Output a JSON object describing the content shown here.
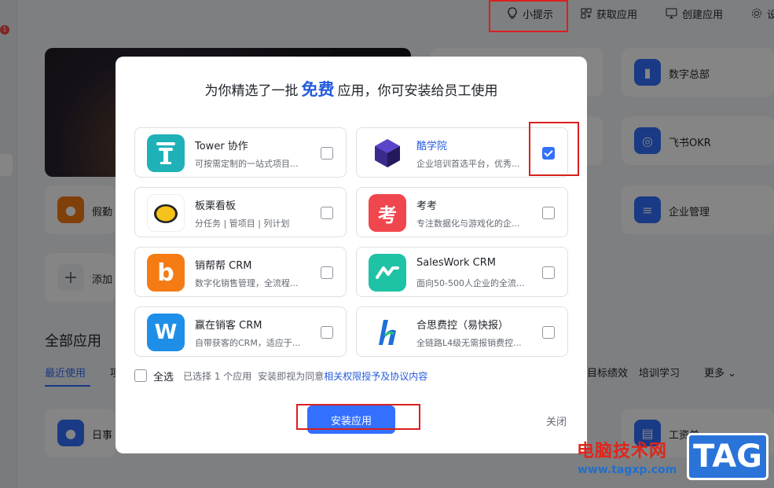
{
  "topbar": {
    "tips": "小提示",
    "get_apps": "获取应用",
    "create_app": "创建应用",
    "settings_partial": "设"
  },
  "background": {
    "cards": [
      "数字总部",
      "飞书OKR",
      "企业管理",
      "假勤",
      "添加"
    ],
    "section_title": "全部应用",
    "tabs": [
      "最近使用",
      "项",
      "目标绩效",
      "培训学习",
      "更多"
    ],
    "bottom_items": [
      "日事",
      "工资单"
    ]
  },
  "modal": {
    "title_prefix": "为你精选了一批",
    "title_highlight": "免费",
    "title_suffix": "应用，你可安装给员工使用",
    "apps": [
      {
        "name": "Tower 协作",
        "desc": "可按需定制的一站式项目...",
        "checked": false,
        "logo_color": "#1fb1b8",
        "icon": "tower-icon"
      },
      {
        "name": "酷学院",
        "desc": "企业培训首选平台，优秀...",
        "checked": true,
        "logo_color": "#3b2a8c",
        "icon": "cube-icon"
      },
      {
        "name": "板栗看板",
        "desc": "分任务 | 管项目 | 列计划",
        "checked": false,
        "logo_color": "#ffffff",
        "icon": "chestnut-icon"
      },
      {
        "name": "考考",
        "desc": "专注数据化与游戏化的企...",
        "checked": false,
        "logo_color": "#f0474e",
        "icon": "kao-icon"
      },
      {
        "name": "销帮帮 CRM",
        "desc": "数字化销售管理，全流程...",
        "checked": false,
        "logo_color": "#f57c15",
        "icon": "b-letter-icon"
      },
      {
        "name": "SalesWork CRM",
        "desc": "面向50-500人企业的全流...",
        "checked": false,
        "logo_color": "#1ec2a4",
        "icon": "saleswork-icon"
      },
      {
        "name": "赢在销客 CRM",
        "desc": "自带获客的CRM，适应于...",
        "checked": false,
        "logo_color": "#1e8fe8",
        "icon": "w-letter-icon"
      },
      {
        "name": "合思费控（易快报）",
        "desc": "全链路L4级无需报销费控...",
        "checked": false,
        "logo_color": "#ffffff",
        "icon": "hesi-icon"
      }
    ],
    "select_all": "全选",
    "selected_count": "已选择 1 个应用",
    "agree_prefix": "安装即视为同意",
    "agree_link": "相关权限授予及协议内容",
    "install_button": "安装应用",
    "close": "关闭"
  },
  "watermark": {
    "line1": "电脑技术网",
    "line2": "www.tagxp.com",
    "tag": "TAG"
  },
  "colors": {
    "accent": "#3370ff",
    "highlight_box": "#d8201f"
  }
}
